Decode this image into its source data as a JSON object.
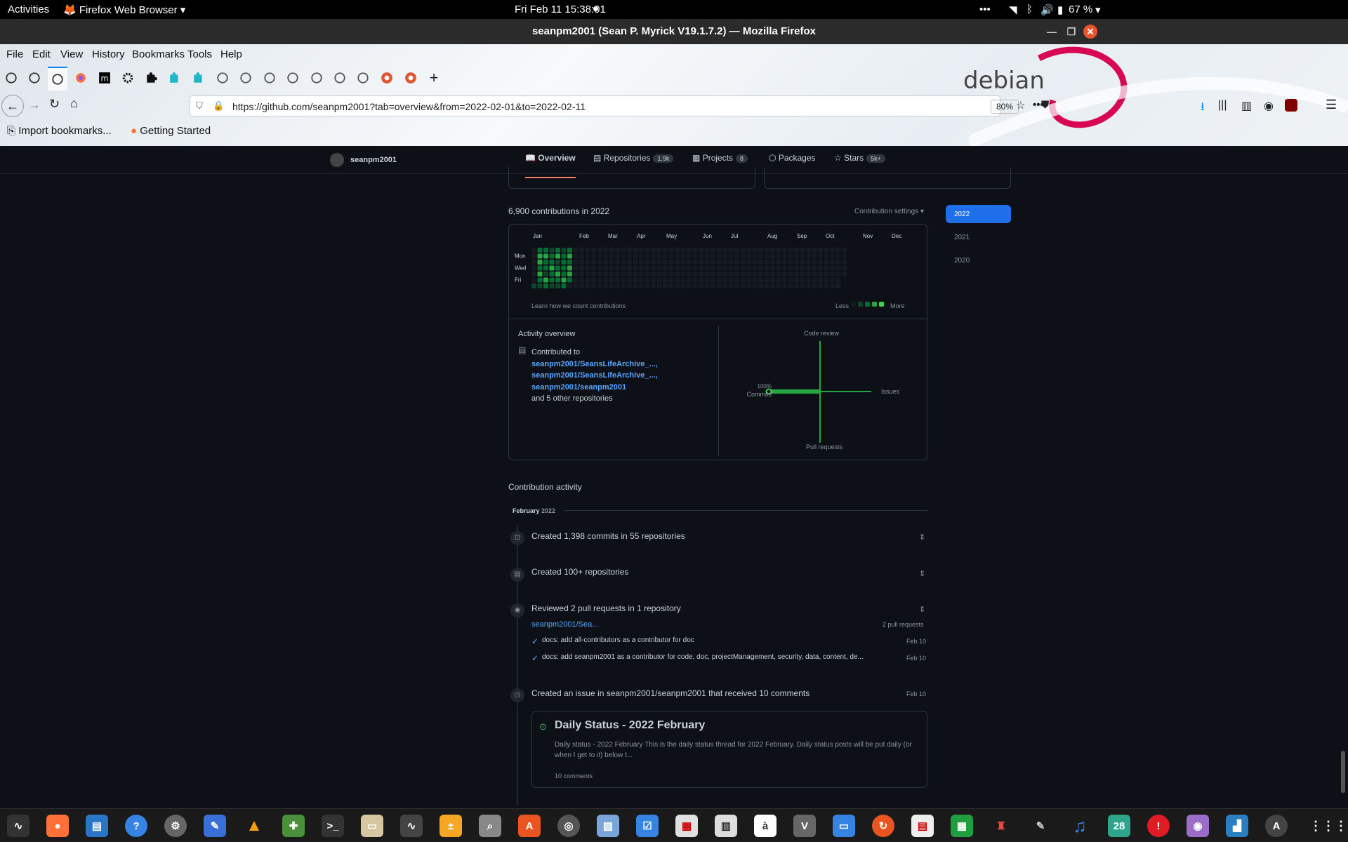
{
  "topbar": {
    "activities": "Activities",
    "app_name": "Firefox Web Browser",
    "clock": "Fri Feb 11  15:38:01",
    "battery": "67 %"
  },
  "window": {
    "title": "seanpm2001 (Sean P. Myrick V19.1.7.2) — Mozilla Firefox"
  },
  "menu": {
    "file": "File",
    "edit": "Edit",
    "view": "View",
    "history": "History",
    "bookmarks": "Bookmarks",
    "tools": "Tools",
    "help": "Help"
  },
  "nav": {
    "url": "https://github.com/seanpm2001?tab=overview&from=2022-02-01&to=2022-02-11",
    "zoom": "80%"
  },
  "theme": {
    "logo_text": "debian"
  },
  "bookmarks_bar": {
    "import": "Import bookmarks...",
    "getting_started": "Getting Started"
  },
  "profile": {
    "username": "seanpm2001",
    "tabs": {
      "overview": "Overview",
      "repositories": "Repositories",
      "repositories_count": "1.9k",
      "projects": "Projects",
      "projects_count": "8",
      "packages": "Packages",
      "stars": "Stars",
      "stars_count": "5k+"
    },
    "contrib_title": "6,900 contributions in 2022",
    "contrib_settings": "Contribution settings ▾",
    "months": [
      "Jan",
      "Feb",
      "Mar",
      "Apr",
      "May",
      "Jun",
      "Jul",
      "Aug",
      "Sep",
      "Oct",
      "Nov",
      "Dec"
    ],
    "days": [
      "Mon",
      "Wed",
      "Fri"
    ],
    "learn": "Learn how we count contributions",
    "less": "Less",
    "more": "More",
    "years": [
      "2022",
      "2021",
      "2020"
    ],
    "activity_overview": "Activity overview",
    "contributed_to": "Contributed to",
    "repo1": "seanpm2001/SeansLifeArchive_...,",
    "repo2": "seanpm2001/SeansLifeArchive_...,",
    "repo3": "seanpm2001/seanpm2001",
    "other_repos": "and 5 other repositories",
    "axes": {
      "code_review": "Code review",
      "issues": "Issues",
      "pull_requests": "Pull requests",
      "commits_pct": "100%",
      "commits": "Commits"
    },
    "contribution_activity": "Contribution activity",
    "month_label": "February",
    "month_year": "2022",
    "events": {
      "commits": "Created 1,398 commits in 55 repositories",
      "repos": "Created 100+ repositories",
      "reviewed": "Reviewed 2 pull requests in 1 repository",
      "review_repo": "seanpm2001/Sea...",
      "review_count": "2 pull requests",
      "pr1": "docs: add all-contributors as a contributor for doc",
      "pr1_date": "Feb 10",
      "pr2": "docs: add seanpm2001 as a contributor for code, doc, projectManagement, security, data, content, de...",
      "pr2_date": "Feb 10",
      "issue": "Created an issue in seanpm2001/seanpm2001 that received 10 comments",
      "issue_date": "Feb 10",
      "issue_title": "Daily Status - 2022 February",
      "issue_body": "Daily status - 2022 February This is the daily status thread for 2022 February. Daily status posts will be put daily (or when I get to it) below t...",
      "issue_comments": "10 comments"
    }
  },
  "contribution_weeks": [
    [
      0,
      0,
      0,
      0,
      0,
      0,
      1
    ],
    [
      2,
      3,
      3,
      2,
      3,
      2,
      1
    ],
    [
      2,
      3,
      2,
      2,
      1,
      3,
      2
    ],
    [
      1,
      2,
      2,
      3,
      2,
      2,
      1
    ],
    [
      2,
      3,
      1,
      2,
      3,
      2,
      1
    ],
    [
      1,
      2,
      2,
      2,
      2,
      3,
      2
    ],
    [
      2,
      3,
      2,
      3,
      3,
      2,
      0
    ]
  ],
  "contribution_colors": [
    "#161b22",
    "#0e4429",
    "#006d32",
    "#26a641",
    "#39d353"
  ],
  "dock": {
    "calendar_day": "28"
  }
}
